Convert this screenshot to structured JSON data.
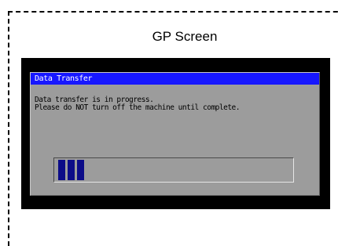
{
  "caption": {
    "title": "GP Screen"
  },
  "dialog": {
    "title": "Data Transfer",
    "message_line1": "Data transfer is in progress.",
    "message_line2": "Please do NOT turn off the machine until complete."
  },
  "progress": {
    "blocks_filled": 3,
    "fraction_complete": 0.1,
    "fill_color": "#0c0c88"
  },
  "colors": {
    "screen_bezel": "#000000",
    "dialog_background": "#9c9c9c",
    "titlebar": "#1717ff",
    "titlebar_text": "#ffffff"
  }
}
